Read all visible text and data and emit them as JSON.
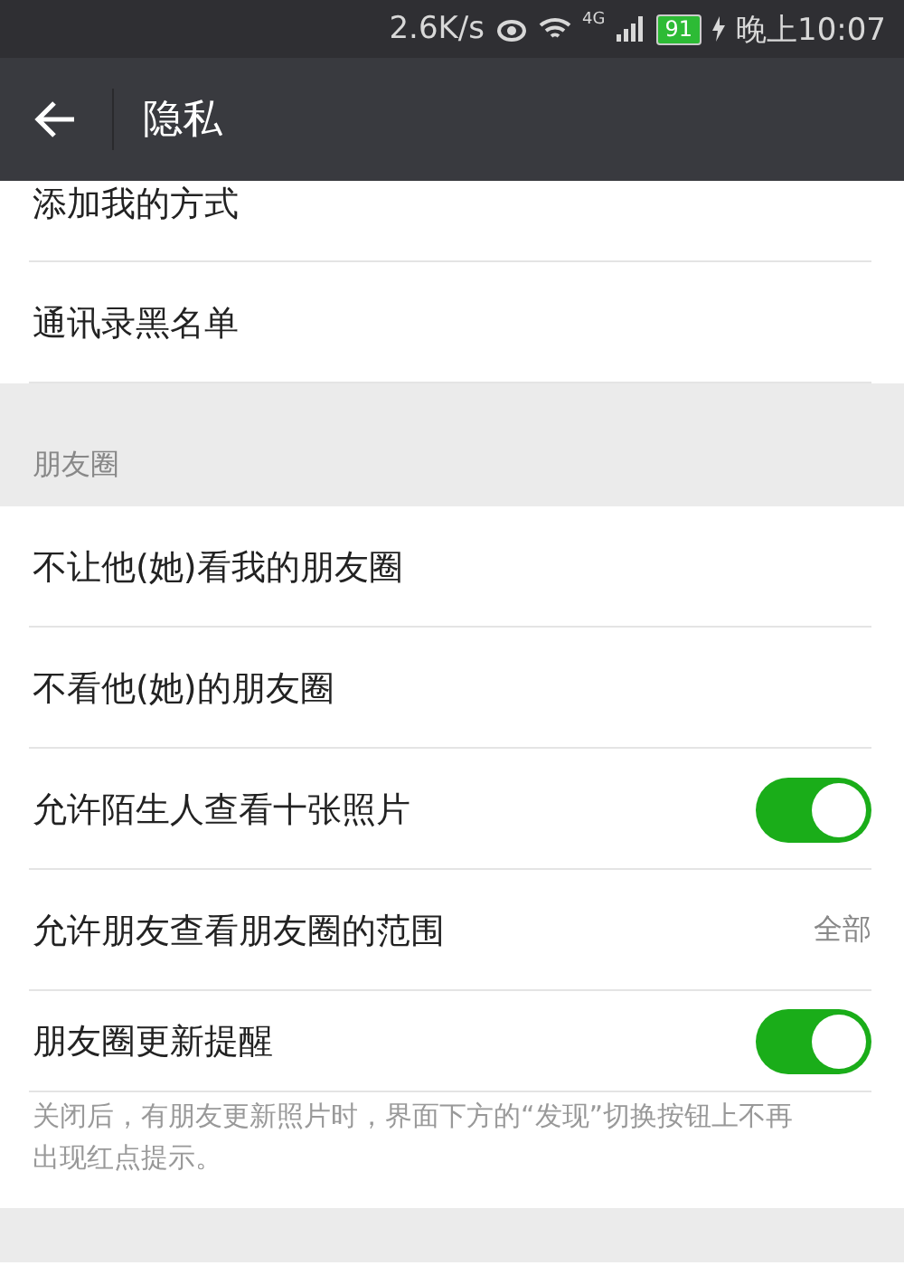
{
  "status_bar": {
    "speed": "2.6K/s",
    "network": "4G",
    "battery": "91",
    "time": "晚上10:07"
  },
  "header": {
    "title": "隐私"
  },
  "top_items": [
    {
      "label": "添加我的方式"
    },
    {
      "label": "通讯录黑名单"
    }
  ],
  "moments": {
    "title": "朋友圈",
    "items": [
      {
        "kind": "link",
        "label": "不让他(她)看我的朋友圈"
      },
      {
        "kind": "link",
        "label": "不看他(她)的朋友圈"
      },
      {
        "kind": "switch",
        "label": "允许陌生人查看十张照片",
        "on": true
      },
      {
        "kind": "value",
        "label": "允许朋友查看朋友圈的范围",
        "value": "全部"
      },
      {
        "kind": "switch",
        "label": "朋友圈更新提醒",
        "on": true
      }
    ],
    "note": "关闭后，有朋友更新照片时，界面下方的“发现”切换按钮上不再出现红点提示。"
  }
}
